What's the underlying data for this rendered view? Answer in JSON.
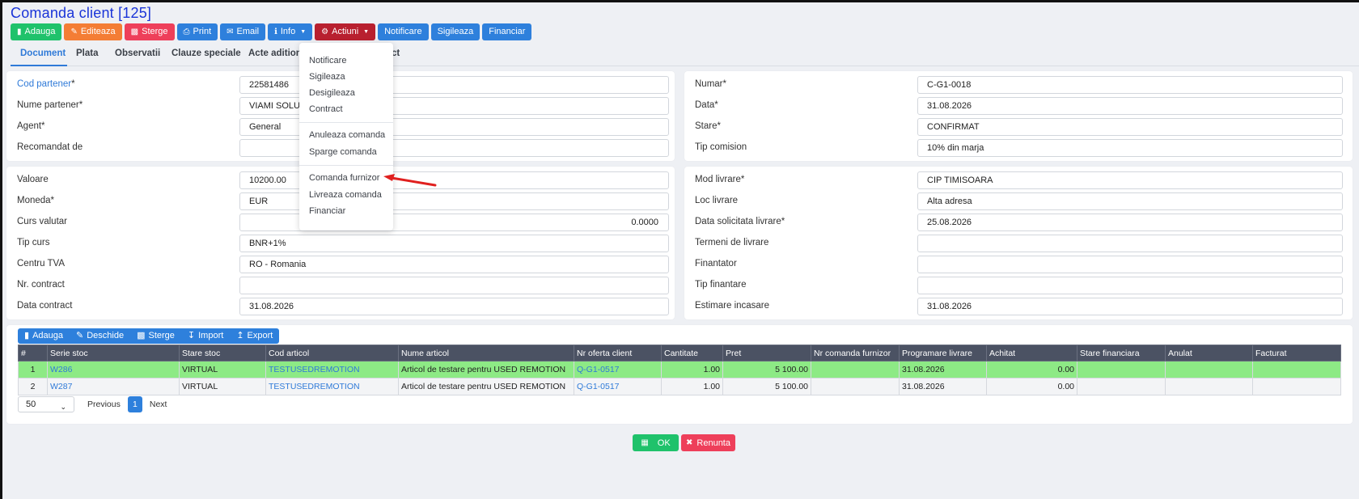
{
  "title": "Comanda client [125]",
  "toolbar": {
    "add": "Adauga",
    "edit": "Editeaza",
    "delete": "Sterge",
    "print": "Print",
    "email": "Email",
    "info": "Info",
    "actions": "Actiuni",
    "notify": "Notificare",
    "seal": "Sigileaza",
    "finance": "Financiar"
  },
  "tabs": [
    "Document",
    "Plata",
    "Observatii",
    "Clauze speciale",
    "Acte aditionale",
    "ct"
  ],
  "partner": {
    "code_label": "Cod partener",
    "code_value": "22581486",
    "name_label": "Nume partener*",
    "name_value": "VIAMI SOLUTIO",
    "agent_label": "Agent*",
    "agent_value": "General",
    "recommended_label": "Recomandat de",
    "recommended_value": ""
  },
  "doc": {
    "number_label": "Numar*",
    "number_value": "C-G1-0018",
    "date_label": "Data*",
    "date_value": "31.08.2026",
    "state_label": "Stare*",
    "state_value": "CONFIRMAT",
    "commission_label": "Tip comision",
    "commission_value": "10% din marja"
  },
  "money": {
    "value_label": "Valoare",
    "value_value": "10200.00",
    "currency_label": "Moneda*",
    "currency_value": "EUR",
    "rate_label": "Curs valutar",
    "rate_value": "0.0000",
    "rate_type_label": "Tip curs",
    "rate_type_value": "BNR+1%",
    "vat_label": "Centru TVA",
    "vat_value": "RO - Romania",
    "contract_no_label": "Nr. contract",
    "contract_no_value": "",
    "contract_date_label": "Data contract",
    "contract_date_value": "31.08.2026"
  },
  "delivery": {
    "mode_label": "Mod livrare*",
    "mode_value": "CIP TIMISOARA",
    "place_label": "Loc livrare",
    "place_value": "Alta adresa",
    "requested_label": "Data solicitata livrare*",
    "requested_value": "25.08.2026",
    "terms_label": "Termeni de livrare",
    "terms_value": "",
    "financer_label": "Finantator",
    "financer_value": "",
    "financing_label": "Tip finantare",
    "financing_value": "",
    "cash_label": "Estimare incasare",
    "cash_value": "31.08.2026"
  },
  "actions_menu": {
    "items": [
      "Notificare",
      "Sigileaza",
      "Desigileaza",
      "Contract",
      "Anuleaza comanda",
      "Sparge comanda",
      "Comanda furnizor",
      "Livreaza comanda",
      "Financiar"
    ]
  },
  "grid_toolbar": {
    "add": "Adauga",
    "open": "Deschide",
    "delete": "Sterge",
    "import": "Import",
    "export": "Export"
  },
  "grid": {
    "columns": [
      "#",
      "Serie stoc",
      "Stare stoc",
      "Cod articol",
      "Nume articol",
      "Nr oferta client",
      "Cantitate",
      "Pret",
      "Nr comanda furnizor",
      "Programare livrare",
      "Achitat",
      "Stare financiara",
      "Anulat",
      "Facturat"
    ],
    "rows": [
      {
        "n": "1",
        "serie": "W286",
        "stare": "VIRTUAL",
        "cod": "TESTUSEDREMOTION",
        "nume": "Articol de testare pentru USED REMOTION",
        "oferta": "Q-G1-0517",
        "cant": "1.00",
        "pret": "5 100.00",
        "furnizor": "",
        "programare": "31.08.2026",
        "achitat": "0.00",
        "fin": "",
        "anulat": "",
        "facturat": ""
      },
      {
        "n": "2",
        "serie": "W287",
        "stare": "VIRTUAL",
        "cod": "TESTUSEDREMOTION",
        "nume": "Articol de testare pentru USED REMOTION",
        "oferta": "Q-G1-0517",
        "cant": "1.00",
        "pret": "5 100.00",
        "furnizor": "",
        "programare": "31.08.2026",
        "achitat": "0.00",
        "fin": "",
        "anulat": "",
        "facturat": ""
      }
    ]
  },
  "pager": {
    "page_size": "50",
    "previous": "Previous",
    "current": "1",
    "next": "Next"
  },
  "footer": {
    "ok": "OK",
    "cancel": "Renunta"
  },
  "colors": {
    "title": "#1a34d8",
    "primary": "#2e80dc",
    "success": "#1fc26b",
    "danger": "#ee3f5a",
    "warning": "#f47d35",
    "selected_row": "#8dea85"
  }
}
